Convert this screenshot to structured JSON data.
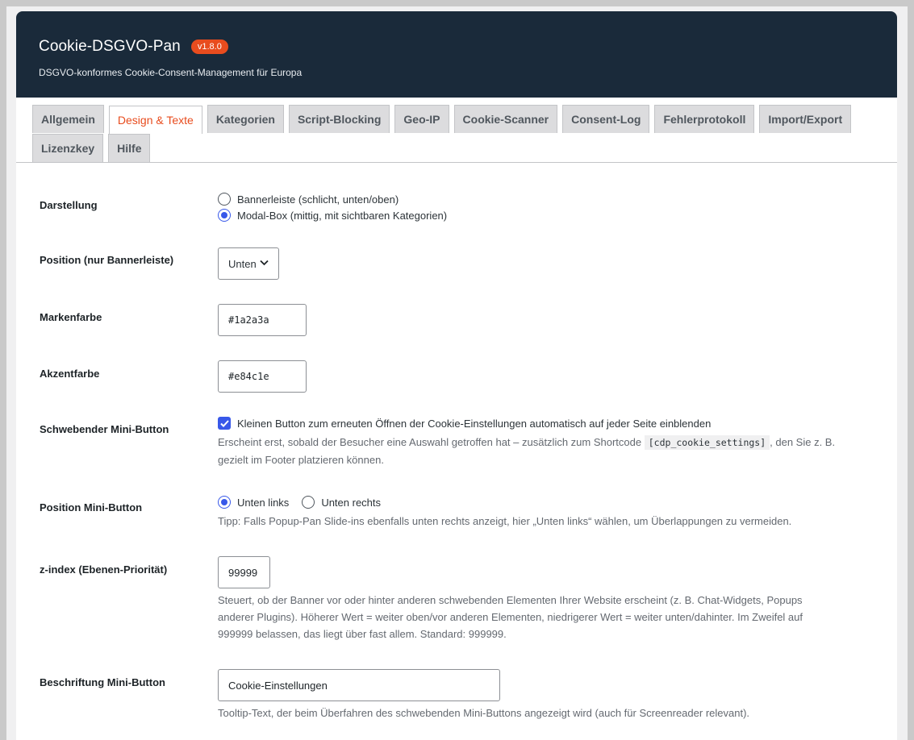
{
  "header": {
    "title": "Cookie-DSGVO-Pan",
    "version": "v1.8.0",
    "subtitle": "DSGVO-konformes Cookie-Consent-Management für Europa"
  },
  "tabs": [
    {
      "label": "Allgemein",
      "active": false
    },
    {
      "label": "Design & Texte",
      "active": true
    },
    {
      "label": "Kategorien",
      "active": false
    },
    {
      "label": "Script-Blocking",
      "active": false
    },
    {
      "label": "Geo-IP",
      "active": false
    },
    {
      "label": "Cookie-Scanner",
      "active": false
    },
    {
      "label": "Consent-Log",
      "active": false
    },
    {
      "label": "Fehlerprotokoll",
      "active": false
    },
    {
      "label": "Import/Export",
      "active": false
    },
    {
      "label": "Lizenzkey",
      "active": false
    },
    {
      "label": "Hilfe",
      "active": false
    }
  ],
  "form": {
    "darstellung": {
      "label": "Darstellung",
      "option1": "Bannerleiste (schlicht, unten/oben)",
      "option2": "Modal-Box (mittig, mit sichtbaren Kategorien)",
      "selected": "option2"
    },
    "position": {
      "label": "Position (nur Bannerleiste)",
      "value": "Unten"
    },
    "markenfarbe": {
      "label": "Markenfarbe",
      "value": "#1a2a3a"
    },
    "akzentfarbe": {
      "label": "Akzentfarbe",
      "value": "#e84c1e"
    },
    "mini_button": {
      "label": "Schwebender Mini-Button",
      "checkbox_label": "Kleinen Button zum erneuten Öffnen der Cookie-Einstellungen automatisch auf jeder Seite einblenden",
      "checked": true,
      "desc_part1": "Erscheint erst, sobald der Besucher eine Auswahl getroffen hat – zusätzlich zum Shortcode",
      "shortcode": "[cdp_cookie_settings]",
      "desc_part2": ", den Sie z. B.",
      "desc_part3": "gezielt im Footer platzieren können."
    },
    "position_mini": {
      "label": "Position Mini-Button",
      "option1": "Unten links",
      "option2": "Unten rechts",
      "selected": "option1",
      "tip": "Tipp: Falls Popup-Pan Slide-ins ebenfalls unten rechts anzeigt, hier „Unten links“ wählen, um Überlappungen zu vermeiden."
    },
    "zindex": {
      "label": "z-index (Ebenen-Priorität)",
      "value": "99999",
      "desc1": "Steuert, ob der Banner vor oder hinter anderen schwebenden Elementen Ihrer Website erscheint (z. B. Chat-Widgets, Popups",
      "desc2": "anderer Plugins). Höherer Wert = weiter oben/vor anderen Elementen, niedrigerer Wert = weiter unten/dahinter. Im Zweifel auf",
      "desc3": "999999 belassen, das liegt über fast allem. Standard: 999999."
    },
    "beschriftung": {
      "label": "Beschriftung Mini-Button",
      "value": "Cookie-Einstellungen",
      "desc": "Tooltip-Text, der beim Überfahren des schwebenden Mini-Buttons angezeigt wird (auch für Screenreader relevant)."
    }
  }
}
